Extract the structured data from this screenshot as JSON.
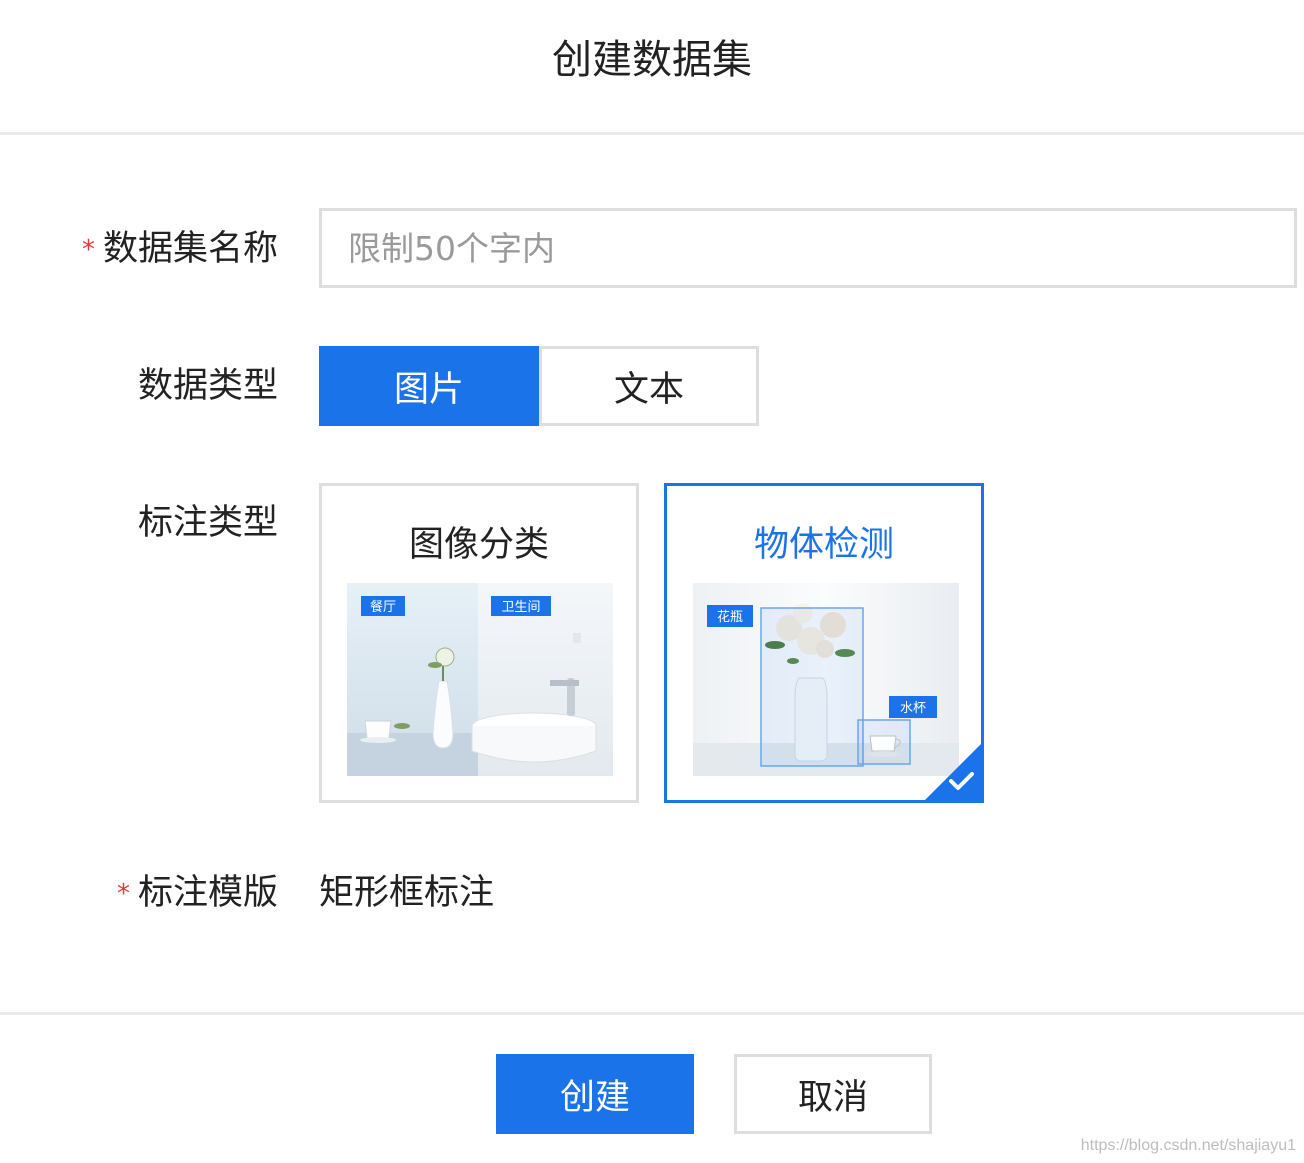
{
  "dialog": {
    "title": "创建数据集"
  },
  "form": {
    "dataset_name": {
      "label": "数据集名称",
      "placeholder": "限制50个字内",
      "value": "",
      "required_mark": "*"
    },
    "data_type": {
      "label": "数据类型",
      "options": [
        "图片",
        "文本"
      ],
      "selected": "图片"
    },
    "annotation_type": {
      "label": "标注类型",
      "options": [
        {
          "title": "图像分类",
          "tags": [
            "餐厅",
            "卫生间"
          ]
        },
        {
          "title": "物体检测",
          "tags": [
            "花瓶",
            "水杯"
          ]
        }
      ],
      "selected": "物体检测"
    },
    "annotation_template": {
      "label": "标注模版",
      "value": "矩形框标注",
      "required_mark": "*"
    }
  },
  "footer": {
    "create_label": "创建",
    "cancel_label": "取消"
  },
  "watermark": "https://blog.csdn.net/shajiayu1",
  "colors": {
    "accent": "#1a73e8",
    "required": "#e23a3a",
    "border": "#dedede"
  }
}
